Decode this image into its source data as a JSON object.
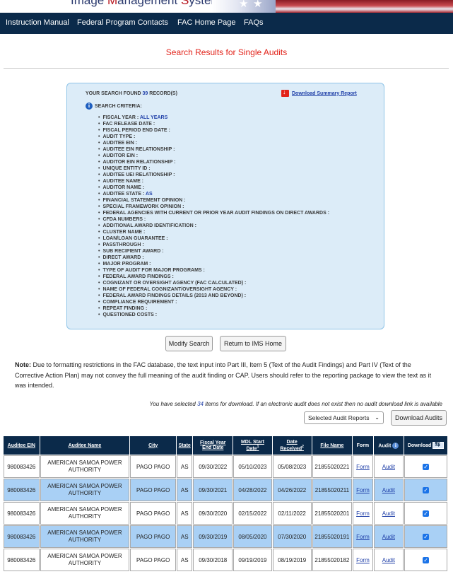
{
  "header": {
    "banner_title_part1": "Image ",
    "banner_title_m": "M",
    "banner_title_part2": "anagement ",
    "banner_title_s": "S",
    "banner_title_part3": "ystem"
  },
  "nav": {
    "items": [
      "Instruction Manual",
      "Federal Program Contacts",
      "FAC Home Page",
      "FAQs"
    ]
  },
  "page": {
    "title": "Search Results for Single Audits"
  },
  "criteria": {
    "found_prefix": "YOUR SEARCH FOUND",
    "found_count": "39",
    "found_suffix": "RECORD(S)",
    "download_summary": "Download Summary Report",
    "search_criteria_label": "SEARCH CRITERIA:",
    "items": [
      {
        "label": "FISCAL YEAR :",
        "value": "ALL YEARS"
      },
      {
        "label": "FAC RELEASE DATE :",
        "value": ""
      },
      {
        "label": "FISCAL PERIOD END DATE :",
        "value": ""
      },
      {
        "label": "AUDIT TYPE :",
        "value": ""
      },
      {
        "label": "AUDITEE EIN :",
        "value": ""
      },
      {
        "label": "AUDITEE EIN RELATIONSHIP :",
        "value": ""
      },
      {
        "label": "AUDITOR EIN :",
        "value": ""
      },
      {
        "label": "AUDITOR EIN RELATIONSHIP :",
        "value": ""
      },
      {
        "label": "UNIQUE ENTITY ID :",
        "value": ""
      },
      {
        "label": "AUDITEE UEI RELATIONSHIP :",
        "value": ""
      },
      {
        "label": "AUDITEE NAME :",
        "value": ""
      },
      {
        "label": "AUDITOR NAME :",
        "value": ""
      },
      {
        "label": "AUDITEE STATE :",
        "value": "AS"
      },
      {
        "label": "FINANCIAL STATEMENT OPINION :",
        "value": ""
      },
      {
        "label": "SPECIAL FRAMEWORK OPINION :",
        "value": ""
      },
      {
        "label": "FEDERAL AGENCIES WITH CURRENT OR PRIOR YEAR AUDIT FINDINGS ON DIRECT AWARDS :",
        "value": ""
      },
      {
        "label": "CFDA NUMBERS :",
        "value": ""
      },
      {
        "label": "ADDITIONAL AWARD IDENTIFICATION :",
        "value": ""
      },
      {
        "label": "CLUSTER NAME :",
        "value": ""
      },
      {
        "label": "LOAN/LOAN GUARANTEE :",
        "value": ""
      },
      {
        "label": "PASSTHROUGH :",
        "value": ""
      },
      {
        "label": "SUB RECIPIENT AWARD :",
        "value": ""
      },
      {
        "label": "DIRECT AWARD :",
        "value": ""
      },
      {
        "label": "MAJOR PROGRAM :",
        "value": ""
      },
      {
        "label": "TYPE OF AUDIT FOR MAJOR PROGRAMS :",
        "value": ""
      },
      {
        "label": "FEDERAL AWARD FINDINGS :",
        "value": ""
      },
      {
        "label": "COGNIZANT OR OVERSIGHT AGENCY (FAC CALCULATED) :",
        "value": ""
      },
      {
        "label": "NAME OF FEDERAL COGNIZANT/OVERSIGHT AGENCY :",
        "value": ""
      },
      {
        "label": "FEDERAL AWARD FINDINGS DETAILS (2013 AND BEYOND) :",
        "value": ""
      },
      {
        "label": "COMPLIANCE REQUIREMENT :",
        "value": ""
      },
      {
        "label": "REPEAT FINDING :",
        "value": ""
      },
      {
        "label": "QUESTIONED COSTS :",
        "value": ""
      }
    ]
  },
  "buttons": {
    "modify_search": "Modify Search",
    "return_ims": "Return to IMS Home",
    "download_audits": "Download Audits"
  },
  "note": {
    "label": "Note:",
    "text": "Due to formatting restrictions in the FAC database, the text input into Part III, Item 5 (Text of the Audit Findings) and Part IV (Text of the Corrective Action Plan) may not convey the full meaning of the audit finding or CAP. Users should refer to the reporting package to view the text as it was intended."
  },
  "selection": {
    "prefix": "You have selected",
    "count": "34",
    "suffix": "items for download. If an electronic audit does not exist then no audit download link is available",
    "dropdown_value": "Selected Audit Reports"
  },
  "table": {
    "headers": {
      "ein": "Auditee EIN",
      "name": "Auditee Name",
      "city": "City",
      "state": "State",
      "fy_end_1": "Fiscal Year",
      "fy_end_2": "End Date",
      "mdl_1": "MDL Start",
      "mdl_2": "Date",
      "mdl_sup": "1",
      "recv_1": "Date",
      "recv_2": "Received",
      "recv_sup": "2",
      "file": "File Name",
      "form": "Form",
      "audit": "Audit",
      "download": "Download"
    },
    "rows": [
      {
        "ein": "980083426",
        "name": "AMERICAN SAMOA POWER AUTHORITY",
        "city": "PAGO PAGO",
        "state": "AS",
        "fy_end": "09/30/2022",
        "mdl_start": "05/10/2023",
        "received": "05/08/2023",
        "file": "21855020221",
        "form": "Form",
        "audit": "Audit"
      },
      {
        "ein": "980083426",
        "name": "AMERICAN SAMOA POWER AUTHORITY",
        "city": "PAGO PAGO",
        "state": "AS",
        "fy_end": "09/30/2021",
        "mdl_start": "04/28/2022",
        "received": "04/26/2022",
        "file": "21855020211",
        "form": "Form",
        "audit": "Audit"
      },
      {
        "ein": "980083426",
        "name": "AMERICAN SAMOA POWER AUTHORITY",
        "city": "PAGO PAGO",
        "state": "AS",
        "fy_end": "09/30/2020",
        "mdl_start": "02/15/2022",
        "received": "02/11/2022",
        "file": "21855020201",
        "form": "Form",
        "audit": "Audit"
      },
      {
        "ein": "980083426",
        "name": "AMERICAN SAMOA POWER AUTHORITY",
        "city": "PAGO PAGO",
        "state": "AS",
        "fy_end": "09/30/2019",
        "mdl_start": "08/05/2020",
        "received": "07/30/2020",
        "file": "21855020191",
        "form": "Form",
        "audit": "Audit"
      },
      {
        "ein": "980083426",
        "name": "AMERICAN SAMOA POWER AUTHORITY",
        "city": "PAGO PAGO",
        "state": "AS",
        "fy_end": "09/30/2018",
        "mdl_start": "09/19/2019",
        "received": "08/19/2019",
        "file": "21855020182",
        "form": "Form",
        "audit": "Audit"
      }
    ]
  }
}
